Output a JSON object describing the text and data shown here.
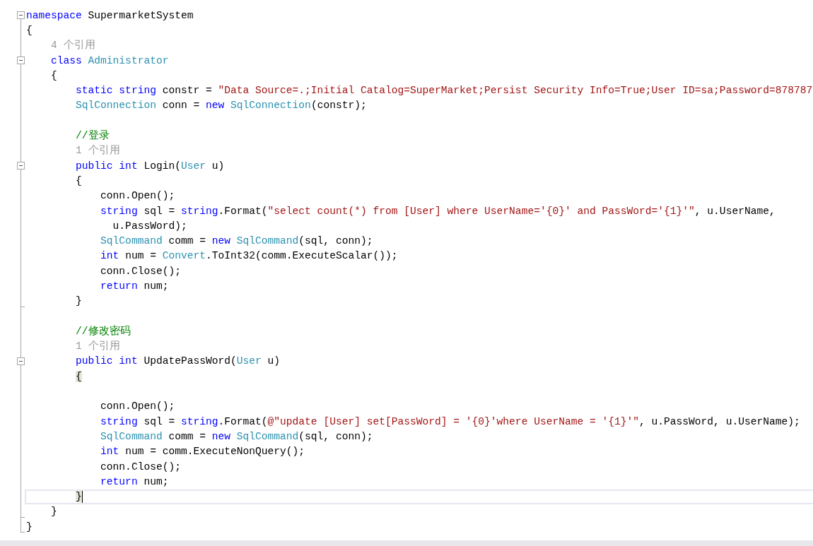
{
  "editor": {
    "lines": [
      {
        "kind": "start",
        "tokens": [
          {
            "kind": "kw",
            "text": "namespace"
          },
          {
            "kind": "txt",
            "text": " SupermarketSystem"
          }
        ]
      },
      {
        "kind": "line",
        "tokens": [
          {
            "kind": "txt",
            "text": "{"
          }
        ]
      },
      {
        "kind": "line",
        "tokens": [
          {
            "kind": "hint",
            "text": "    4 个引用"
          }
        ]
      },
      {
        "kind": "start",
        "tokens": [
          {
            "kind": "kw",
            "text": "    class "
          },
          {
            "kind": "type",
            "text": "Administrator"
          }
        ]
      },
      {
        "kind": "line",
        "tokens": [
          {
            "kind": "txt",
            "text": "    {"
          }
        ]
      },
      {
        "kind": "line",
        "tokens": [
          {
            "kind": "kw",
            "text": "        static string"
          },
          {
            "kind": "txt",
            "text": " constr = "
          },
          {
            "kind": "str",
            "text": "\"Data Source=.;Initial Catalog=SuperMarket;Persist Security Info=True;User ID=sa;Password=878787"
          }
        ]
      },
      {
        "kind": "line",
        "tokens": [
          {
            "kind": "type",
            "text": "        SqlConnection"
          },
          {
            "kind": "txt",
            "text": " conn = "
          },
          {
            "kind": "kw",
            "text": "new "
          },
          {
            "kind": "type",
            "text": "SqlConnection"
          },
          {
            "kind": "txt",
            "text": "(constr);"
          }
        ]
      },
      {
        "kind": "line"
      },
      {
        "kind": "line",
        "tokens": [
          {
            "kind": "cmt",
            "text": "        //登录"
          }
        ]
      },
      {
        "kind": "line",
        "tokens": [
          {
            "kind": "hint",
            "text": "        1 个引用"
          }
        ]
      },
      {
        "kind": "start",
        "tokens": [
          {
            "kind": "kw",
            "text": "        public int"
          },
          {
            "kind": "txt",
            "text": " Login("
          },
          {
            "kind": "type",
            "text": "User"
          },
          {
            "kind": "txt",
            "text": " u)"
          }
        ]
      },
      {
        "kind": "line",
        "tokens": [
          {
            "kind": "txt",
            "text": "        {"
          }
        ]
      },
      {
        "kind": "line",
        "tokens": [
          {
            "kind": "txt",
            "text": "            conn.Open();"
          }
        ]
      },
      {
        "kind": "line",
        "tokens": [
          {
            "kind": "kw",
            "text": "            string"
          },
          {
            "kind": "txt",
            "text": " sql = "
          },
          {
            "kind": "kw",
            "text": "string"
          },
          {
            "kind": "txt",
            "text": ".Format("
          },
          {
            "kind": "str",
            "text": "\"select count(*) from [User] where UserName='{0}' and PassWord='{1}'\""
          },
          {
            "kind": "txt",
            "text": ", u.UserName,"
          }
        ]
      },
      {
        "kind": "line",
        "tokens": [
          {
            "kind": "txt",
            "text": "              u.PassWord);"
          }
        ]
      },
      {
        "kind": "line",
        "tokens": [
          {
            "kind": "type",
            "text": "            SqlCommand"
          },
          {
            "kind": "txt",
            "text": " comm = "
          },
          {
            "kind": "kw",
            "text": "new "
          },
          {
            "kind": "type",
            "text": "SqlCommand"
          },
          {
            "kind": "txt",
            "text": "(sql, conn);"
          }
        ]
      },
      {
        "kind": "line",
        "tokens": [
          {
            "kind": "kw",
            "text": "            int"
          },
          {
            "kind": "txt",
            "text": " num = "
          },
          {
            "kind": "type",
            "text": "Convert"
          },
          {
            "kind": "txt",
            "text": ".ToInt32(comm.ExecuteScalar());"
          }
        ]
      },
      {
        "kind": "line",
        "tokens": [
          {
            "kind": "txt",
            "text": "            conn.Close();"
          }
        ]
      },
      {
        "kind": "line",
        "tokens": [
          {
            "kind": "kw",
            "text": "            return"
          },
          {
            "kind": "txt",
            "text": " num;"
          }
        ]
      },
      {
        "kind": "end",
        "tokens": [
          {
            "kind": "txt",
            "text": "        }"
          }
        ]
      },
      {
        "kind": "line"
      },
      {
        "kind": "line",
        "tokens": [
          {
            "kind": "cmt",
            "text": "        //修改密码"
          }
        ]
      },
      {
        "kind": "line",
        "tokens": [
          {
            "kind": "hint",
            "text": "        1 个引用"
          }
        ]
      },
      {
        "kind": "start",
        "tokens": [
          {
            "kind": "kw",
            "text": "        public int"
          },
          {
            "kind": "txt",
            "text": " UpdatePassWord("
          },
          {
            "kind": "type",
            "text": "User"
          },
          {
            "kind": "txt",
            "text": " u)"
          }
        ]
      },
      {
        "kind": "line",
        "tokens": [
          {
            "kind": "match",
            "text": "        {"
          }
        ]
      },
      {
        "kind": "line"
      },
      {
        "kind": "line",
        "tokens": [
          {
            "kind": "txt",
            "text": "            conn.Open();"
          }
        ]
      },
      {
        "kind": "line",
        "tokens": [
          {
            "kind": "kw",
            "text": "            string"
          },
          {
            "kind": "txt",
            "text": " sql = "
          },
          {
            "kind": "kw",
            "text": "string"
          },
          {
            "kind": "txt",
            "text": ".Format("
          },
          {
            "kind": "str",
            "text": "@\"update [User] set[PassWord] = '{0}'where UserName = '{1}'\""
          },
          {
            "kind": "txt",
            "text": ", u.PassWord, u.UserName);"
          }
        ]
      },
      {
        "kind": "line",
        "tokens": [
          {
            "kind": "type",
            "text": "            SqlCommand"
          },
          {
            "kind": "txt",
            "text": " comm = "
          },
          {
            "kind": "kw",
            "text": "new "
          },
          {
            "kind": "type",
            "text": "SqlCommand"
          },
          {
            "kind": "txt",
            "text": "(sql, conn);"
          }
        ]
      },
      {
        "kind": "line",
        "tokens": [
          {
            "kind": "kw",
            "text": "            int"
          },
          {
            "kind": "txt",
            "text": " num = comm.ExecuteNonQuery();"
          }
        ]
      },
      {
        "kind": "line",
        "tokens": [
          {
            "kind": "txt",
            "text": "            conn.Close();"
          }
        ]
      },
      {
        "kind": "line",
        "tokens": [
          {
            "kind": "kw",
            "text": "            return"
          },
          {
            "kind": "txt",
            "text": " num;"
          }
        ]
      },
      {
        "kind": "line",
        "current": true,
        "tokens": [
          {
            "kind": "match",
            "text": "        }"
          }
        ]
      },
      {
        "kind": "end",
        "tokens": [
          {
            "kind": "txt",
            "text": "    }"
          }
        ]
      },
      {
        "kind": "end",
        "tokens": [
          {
            "kind": "txt",
            "text": "}"
          }
        ]
      }
    ]
  }
}
